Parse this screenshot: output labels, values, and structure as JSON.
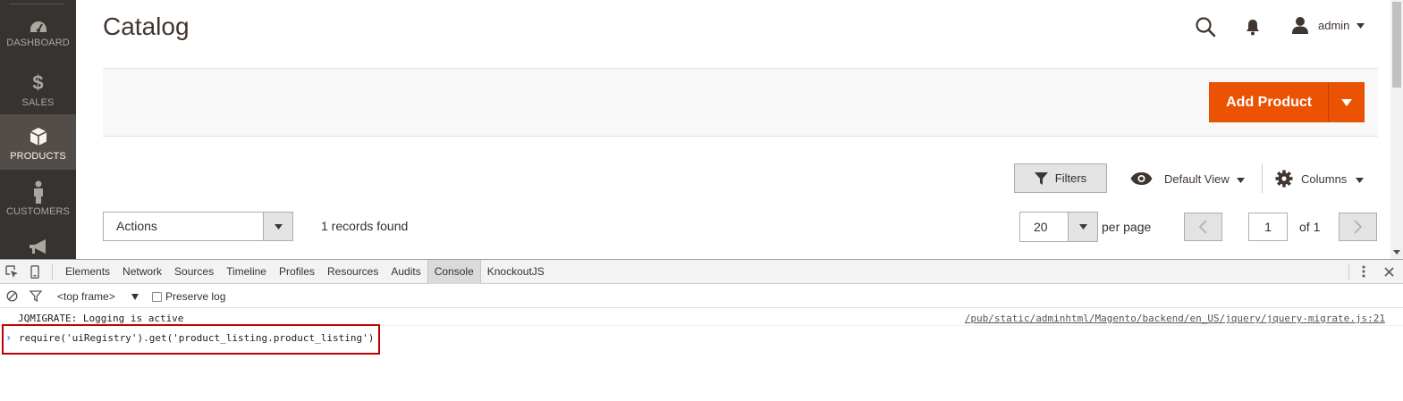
{
  "sidebar": {
    "items": [
      {
        "label": "DASHBOARD",
        "icon": "dashboard-icon"
      },
      {
        "label": "SALES",
        "icon": "dollar-icon",
        "glyph": "$"
      },
      {
        "label": "PRODUCTS",
        "icon": "box-icon",
        "active": true
      },
      {
        "label": "CUSTOMERS",
        "icon": "person-icon"
      },
      {
        "label": "",
        "icon": "megaphone-icon"
      }
    ]
  },
  "header": {
    "title": "Catalog",
    "user_name": "admin",
    "icons": [
      "search-icon",
      "bell-icon",
      "user-icon",
      "caret-down-icon"
    ]
  },
  "action_bar": {
    "add_product_label": "Add Product"
  },
  "toolbar": {
    "filters_label": "Filters",
    "view_label": "Default View",
    "columns_label": "Columns"
  },
  "grid": {
    "actions_label": "Actions",
    "records_found": "1 records found",
    "per_page_value": "20",
    "per_page_label": "per page",
    "current_page": "1",
    "page_total": "of 1"
  },
  "devtools": {
    "tabs": [
      {
        "label": "Elements"
      },
      {
        "label": "Network"
      },
      {
        "label": "Sources"
      },
      {
        "label": "Timeline"
      },
      {
        "label": "Profiles"
      },
      {
        "label": "Resources"
      },
      {
        "label": "Audits"
      },
      {
        "label": "Console",
        "active": true
      },
      {
        "label": "KnockoutJS"
      }
    ],
    "frame": "<top frame>",
    "preserve_log_label": "Preserve log",
    "preserve_log_checked": false,
    "log_message": "JQMIGRATE: Logging is active",
    "log_source": "/pub/static/adminhtml/Magento/backend/en_US/jquery/jquery-migrate.js:21",
    "prompt_command": "require('uiRegistry').get('product_listing.product_listing')"
  },
  "colors": {
    "brand_orange": "#eb5202",
    "sidebar_bg": "#373330",
    "sidebar_active": "#524d49",
    "highlight_red": "#c00000"
  }
}
